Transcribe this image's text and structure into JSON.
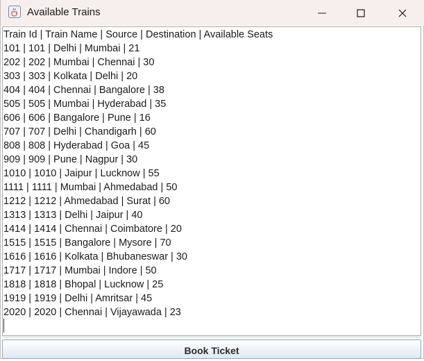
{
  "window": {
    "title": "Available Trains",
    "app_icon": "java-cup-icon"
  },
  "text_area": {
    "header": "Train Id | Train Name | Source | Destination | Available Seats",
    "rows": [
      "101 | 101 | Delhi | Mumbai | 21",
      "202 | 202 | Mumbai | Chennai | 30",
      "303 | 303 | Kolkata | Delhi | 20",
      "404 | 404 | Chennai | Bangalore | 38",
      "505 | 505 | Mumbai | Hyderabad | 35",
      "606 | 606 | Bangalore | Pune | 16",
      "707 | 707 | Delhi | Chandigarh | 60",
      "808 | 808 | Hyderabad | Goa | 45",
      "909 | 909 | Pune | Nagpur | 30",
      "1010 | 1010 | Jaipur | Lucknow | 55",
      "1111 | 1111 | Mumbai | Ahmedabad | 50",
      "1212 | 1212 | Ahmedabad | Surat | 60",
      "1313 | 1313 | Delhi | Jaipur | 40",
      "1414 | 1414 | Chennai | Coimbatore | 20",
      "1515 | 1515 | Bangalore | Mysore | 70",
      "1616 | 1616 | Kolkata | Bhubaneswar | 30",
      "1717 | 1717 | Mumbai | Indore | 50",
      "1818 | 1818 | Bhopal | Lucknow | 25",
      "1919 | 1919 | Delhi | Amritsar | 45",
      "2020 | 2020 | Chennai | Vijayawada | 23"
    ]
  },
  "book_button": {
    "label": "Book Ticket"
  }
}
